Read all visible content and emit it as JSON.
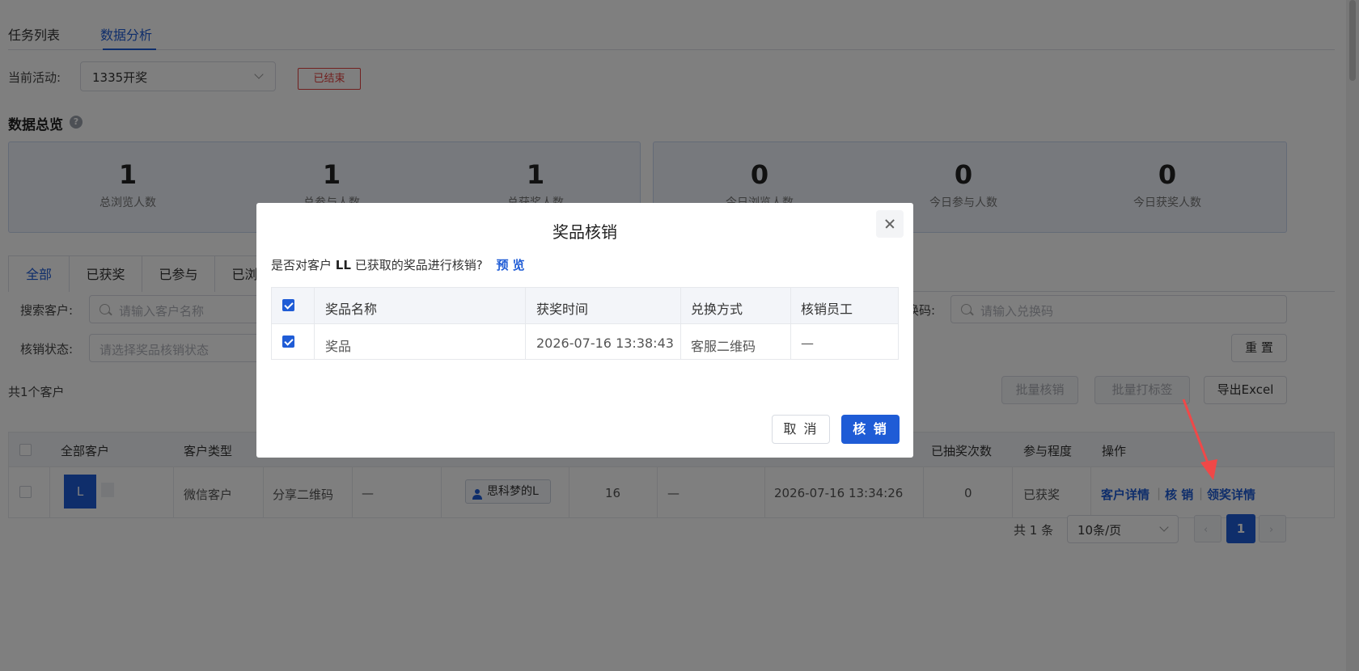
{
  "tabs": [
    {
      "label": "任务列表"
    },
    {
      "label": "数据分析"
    }
  ],
  "activity": {
    "label": "当前活动:",
    "value": "1335开奖",
    "status": "已结束"
  },
  "overview": {
    "title": "数据总览",
    "help": "?"
  },
  "stats": [
    {
      "value": "1",
      "label": "总浏览人数"
    },
    {
      "value": "1",
      "label": "总参与人数"
    },
    {
      "value": "1",
      "label": "总获奖人数"
    },
    {
      "value": "0",
      "label": "今日浏览人数"
    },
    {
      "value": "0",
      "label": "今日参与人数"
    },
    {
      "value": "0",
      "label": "今日获奖人数"
    }
  ],
  "segments": [
    {
      "label": "全部"
    },
    {
      "label": "已获奖"
    },
    {
      "label": "已参与"
    },
    {
      "label": "已浏览"
    }
  ],
  "filters": {
    "customer_label": "搜索客户:",
    "customer_placeholder": "请输入客户名称",
    "status_label": "核销状态:",
    "status_placeholder": "请选择奖品核销状态",
    "code_label": "搜索兑换码:",
    "code_placeholder": "请输入兑换码",
    "reset": "重 置"
  },
  "list": {
    "count_text": "共1个客户",
    "batch_verify": "批量核销",
    "batch_tag": "批量打标签",
    "export": "导出Excel"
  },
  "table": {
    "headers": [
      "全部客户",
      "客户类型",
      "已抽奖次数",
      "参与程度",
      "操作"
    ],
    "row": {
      "avatar": "L",
      "type": "微信客户",
      "source": "分享二维码",
      "dash1": "—",
      "staff": "思科梦的L",
      "count": "16",
      "dash2": "—",
      "time": "2026-07-16 13:34:26",
      "draws": "0",
      "level": "已获奖",
      "actions": [
        "客户详情",
        "核 销",
        "领奖详情"
      ]
    }
  },
  "pagination": {
    "total": "共 1 条",
    "page_size": "10条/页",
    "current": "1"
  },
  "modal": {
    "title": "奖品核销",
    "question_pre": "是否对客户",
    "customer": "LL",
    "question_post": "已获取的奖品进行核销?",
    "preview": "预 览",
    "headers": [
      "奖品名称",
      "获奖时间",
      "兑换方式",
      "核销员工"
    ],
    "rows": [
      {
        "name": "奖品",
        "time": "2026-07-16 13:38:43",
        "method": "客服二维码",
        "staff": "—"
      }
    ],
    "cancel": "取 消",
    "confirm": "核 销"
  }
}
